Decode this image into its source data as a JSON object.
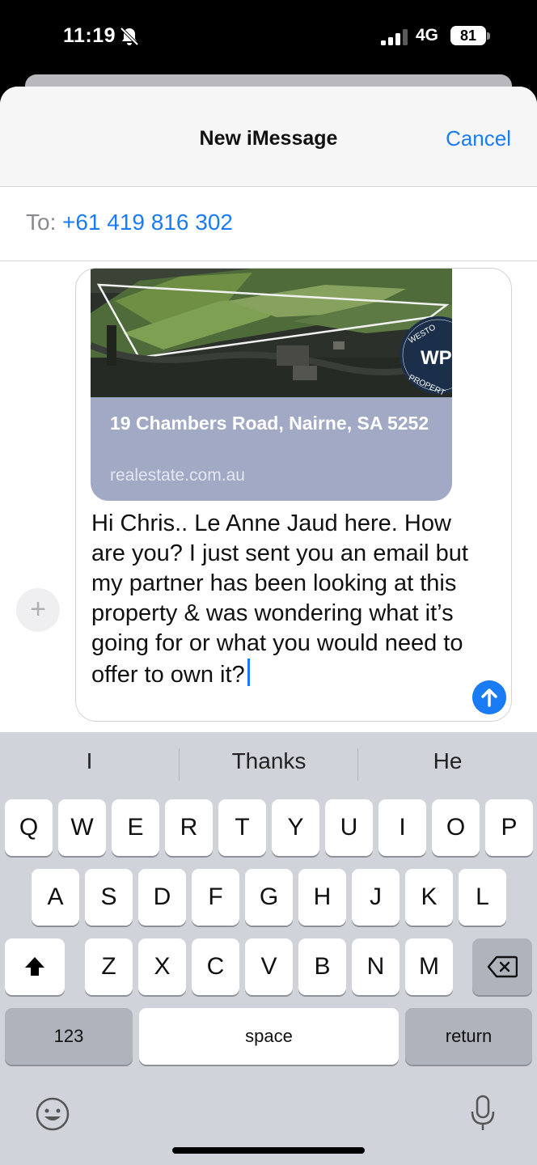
{
  "status": {
    "time": "11:19",
    "network": "4G",
    "battery": "81"
  },
  "nav": {
    "title": "New iMessage",
    "cancel": "Cancel"
  },
  "recipient": {
    "label": "To:",
    "value": "+61 419 816 302"
  },
  "link_preview": {
    "title": "19 Chambers Road, Nairne, SA 5252",
    "domain": "realestate.com.au",
    "logo_text": "WP",
    "logo_ring": "WESTON PROPERTY"
  },
  "message": {
    "text": "Hi Chris.. Le Anne Jaud here. How are you? I just sent you an email but my partner has been looking at this property & was wondering what it’s going for or what you would need to offer to own it?"
  },
  "predictions": [
    "I",
    "Thanks",
    "He"
  ],
  "keyboard": {
    "row1": [
      "Q",
      "W",
      "E",
      "R",
      "T",
      "Y",
      "U",
      "I",
      "O",
      "P"
    ],
    "row2": [
      "A",
      "S",
      "D",
      "F",
      "G",
      "H",
      "J",
      "K",
      "L"
    ],
    "row3": [
      "Z",
      "X",
      "C",
      "V",
      "B",
      "N",
      "M"
    ],
    "numbers": "123",
    "space": "space",
    "return": "return"
  },
  "colors": {
    "accent": "#1a7cf5",
    "link_card": "#a2a9c5",
    "keyboard_bg": "#d0d3d9"
  },
  "icons": [
    "bell-slash-icon",
    "signal-icon",
    "battery-icon",
    "plus-icon",
    "send-arrow-icon",
    "shift-icon",
    "delete-icon",
    "emoji-icon",
    "microphone-icon"
  ]
}
